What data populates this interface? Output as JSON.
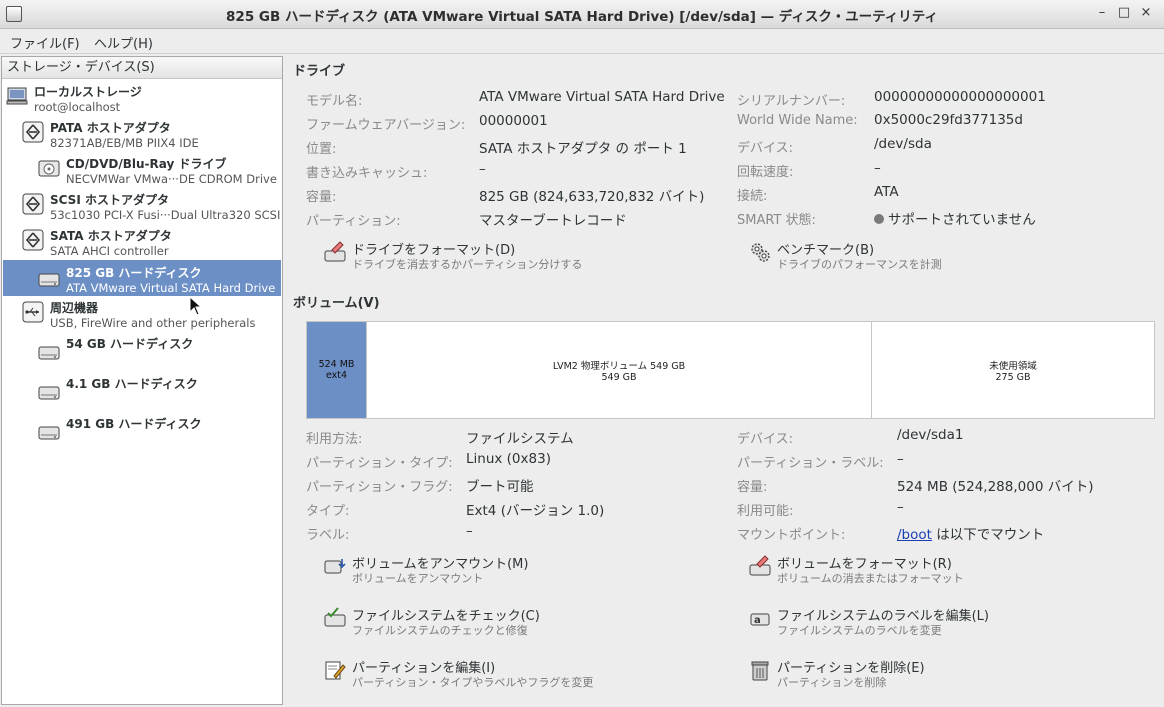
{
  "window": {
    "title": "825 GB ハードディスク (ATA VMware Virtual SATA Hard Drive) [/dev/sda] — ディスク・ユーティリティ",
    "minimize": "–",
    "maximize": "□",
    "close": "×"
  },
  "menu": {
    "file": "ファイル(F)",
    "help": "ヘルプ(H)"
  },
  "sidebar": {
    "header": "ストレージ・デバイス(S)",
    "items": [
      {
        "title": "ローカルストレージ",
        "subtitle": "root@localhost",
        "icon": "computer-icon"
      },
      {
        "title": "PATA ホストアダプタ",
        "subtitle": "82371AB/EB/MB PIIX4 IDE",
        "icon": "host-adapter-icon"
      },
      {
        "title": "CD/DVD/Blu-Ray ドライブ",
        "subtitle": "NECVMWar VMwa···DE CDROM Drive",
        "icon": "optical-drive-icon"
      },
      {
        "title": "SCSI ホストアダプタ",
        "subtitle": "53c1030 PCI-X Fusi···Dual Ultra320 SCSI",
        "icon": "host-adapter-icon"
      },
      {
        "title": "SATA ホストアダプタ",
        "subtitle": "SATA AHCI controller",
        "icon": "host-adapter-icon"
      },
      {
        "title": "825 GB ハードディスク",
        "subtitle": "ATA VMware Virtual SATA Hard Drive",
        "icon": "hard-disk-icon"
      },
      {
        "title": "周辺機器",
        "subtitle": "USB, FireWire and other peripherals",
        "icon": "usb-icon"
      },
      {
        "title": "54 GB ハードディスク",
        "subtitle": "",
        "icon": "hard-disk-icon"
      },
      {
        "title": "4.1 GB ハードディスク",
        "subtitle": "",
        "icon": "hard-disk-icon"
      },
      {
        "title": "491 GB ハードディスク",
        "subtitle": "",
        "icon": "hard-disk-icon"
      }
    ]
  },
  "drive": {
    "heading": "ドライブ",
    "left": [
      {
        "label": "モデル名:",
        "value": "ATA VMware Virtual SATA Hard Drive"
      },
      {
        "label": "ファームウェアバージョン:",
        "value": "00000001"
      },
      {
        "label": "位置:",
        "value": "SATA ホストアダプタ の ポート 1"
      },
      {
        "label": "書き込みキャッシュ:",
        "value": "–"
      },
      {
        "label": "容量:",
        "value": "825 GB (824,633,720,832 バイト)"
      },
      {
        "label": "パーティション:",
        "value": "マスターブートレコード"
      }
    ],
    "right": [
      {
        "label": "シリアルナンバー:",
        "value": "00000000000000000001"
      },
      {
        "label": "World Wide Name:",
        "value": "0x5000c29fd377135d"
      },
      {
        "label": "デバイス:",
        "value": "/dev/sda"
      },
      {
        "label": "回転速度:",
        "value": "–"
      },
      {
        "label": "接続:",
        "value": "ATA"
      },
      {
        "label": "SMART 状態:",
        "value": "サポートされていません"
      }
    ],
    "actions": [
      {
        "title": "ドライブをフォーマット(D)",
        "desc": "ドライブを消去するかパーティション分けする"
      },
      {
        "title": "ベンチマーク(B)",
        "desc": "ドライブのパフォーマンスを計測"
      }
    ]
  },
  "volumes": {
    "heading": "ボリューム(V)",
    "segments": [
      {
        "line1": "524 MB ext4",
        "line2": ""
      },
      {
        "line1": "LVM2 物理ボリューム 549 GB",
        "line2": "549 GB"
      },
      {
        "line1": "未使用領域",
        "line2": "275 GB"
      }
    ],
    "left": [
      {
        "label": "利用方法:",
        "value": "ファイルシステム"
      },
      {
        "label": "パーティション・タイプ:",
        "value": "Linux (0x83)"
      },
      {
        "label": "パーティション・フラグ:",
        "value": "ブート可能"
      },
      {
        "label": "タイプ:",
        "value": "Ext4 (バージョン 1.0)"
      },
      {
        "label": "ラベル:",
        "value": "–"
      }
    ],
    "right": [
      {
        "label": "デバイス:",
        "value": "/dev/sda1"
      },
      {
        "label": "パーティション・ラベル:",
        "value": "–"
      },
      {
        "label": "容量:",
        "value": "524 MB (524,288,000 バイト)"
      },
      {
        "label": "利用可能:",
        "value": "–"
      },
      {
        "label": "マウントポイント:",
        "link": "/boot",
        "value_suffix": " は以下でマウント"
      }
    ],
    "actions": [
      {
        "title": "ボリュームをアンマウント(M)",
        "desc": "ボリュームをアンマウント"
      },
      {
        "title": "ボリュームをフォーマット(R)",
        "desc": "ボリュームの消去またはフォーマット"
      },
      {
        "title": "ファイルシステムをチェック(C)",
        "desc": "ファイルシステムのチェックと修復"
      },
      {
        "title": "ファイルシステムのラベルを編集(L)",
        "desc": "ファイルシステムのラベルを変更"
      },
      {
        "title": "パーティションを編集(I)",
        "desc": "パーティション・タイプやラベルやフラグを変更"
      },
      {
        "title": "パーティションを削除(E)",
        "desc": "パーティションを削除"
      }
    ]
  },
  "colors": {
    "selection": "#6c8fc6",
    "link": "#1a3fb5"
  }
}
